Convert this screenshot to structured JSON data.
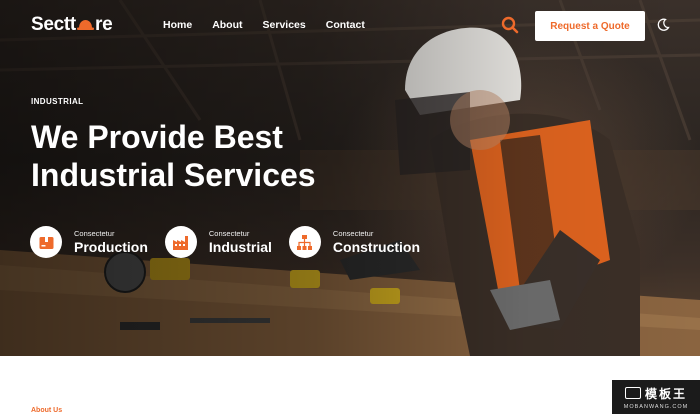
{
  "header": {
    "logo_text_left": "Sectt",
    "logo_text_right": "re",
    "nav": [
      "Home",
      "About",
      "Services",
      "Contact"
    ],
    "cta_label": "Request a Quote"
  },
  "hero": {
    "eyebrow": "INDUSTRIAL",
    "headline_line1": "We Provide Best",
    "headline_line2": "Industrial Services",
    "features": [
      {
        "kicker": "Consectetur",
        "title": "Production",
        "icon": "box-icon"
      },
      {
        "kicker": "Consectetur",
        "title": "Industrial",
        "icon": "factory-icon"
      },
      {
        "kicker": "Consectetur",
        "title": "Construction",
        "icon": "hierarchy-icon"
      }
    ]
  },
  "section": {
    "about_label": "About Us"
  },
  "watermark": {
    "top": "模板王",
    "bottom": "MOBANWANG.COM"
  },
  "colors": {
    "accent": "#ee6a2b",
    "white": "#ffffff"
  }
}
